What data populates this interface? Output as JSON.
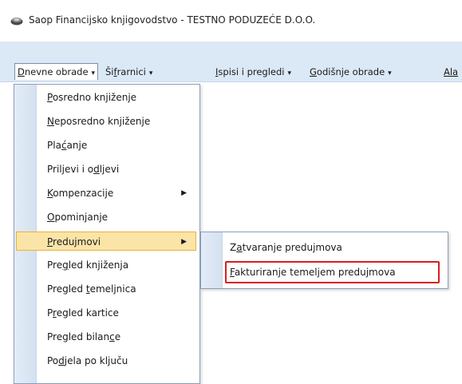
{
  "window": {
    "title": "Saop Financijsko knjigovodstvo - TESTNO PODUZEĆE D.O.O."
  },
  "menubar": {
    "items": [
      {
        "first": "D",
        "rest": "nevne obrade",
        "arrow": "▾"
      },
      {
        "pre": "Ši",
        "u": "f",
        "post": "rarnici",
        "arrow": "▾"
      },
      {
        "first": "I",
        "rest": "spisi i pregledi",
        "arrow": "▾"
      },
      {
        "first": "G",
        "rest": "odišnje obrade",
        "arrow": "▾"
      },
      {
        "pre": "",
        "u": "Ala",
        "post": ""
      }
    ]
  },
  "dropdown": {
    "items": [
      {
        "pre": "",
        "u": "P",
        "post": "osredno knjiženje"
      },
      {
        "pre": "",
        "u": "N",
        "post": "eposredno knjiženje"
      },
      {
        "pre": "Pla",
        "u": "ć",
        "post": "anje"
      },
      {
        "pre": "Priljevi i o",
        "u": "d",
        "post": "ljevi"
      },
      {
        "pre": "",
        "u": "K",
        "post": "ompenzacije",
        "submenu": "▶"
      },
      {
        "pre": "",
        "u": "O",
        "post": "pominjanje"
      },
      {
        "pre": "",
        "u": "P",
        "post": "redujmovi",
        "submenu": "▶"
      },
      {
        "pre": "Pre",
        "u": "g",
        "post": "led knjiženja"
      },
      {
        "pre": "Pregled ",
        "u": "t",
        "post": "emeljnica"
      },
      {
        "pre": "P",
        "u": "r",
        "post": "egled kartice"
      },
      {
        "pre": "Pregled bilan",
        "u": "c",
        "post": "e"
      },
      {
        "pre": "Po",
        "u": "d",
        "post": "jela po ključu"
      }
    ]
  },
  "submenu": {
    "items": [
      {
        "pre": "Z",
        "u": "a",
        "post": "tvaranje predujmova"
      },
      {
        "pre": "",
        "u": "F",
        "post": "akturiranje temeljem predujmova"
      }
    ]
  }
}
